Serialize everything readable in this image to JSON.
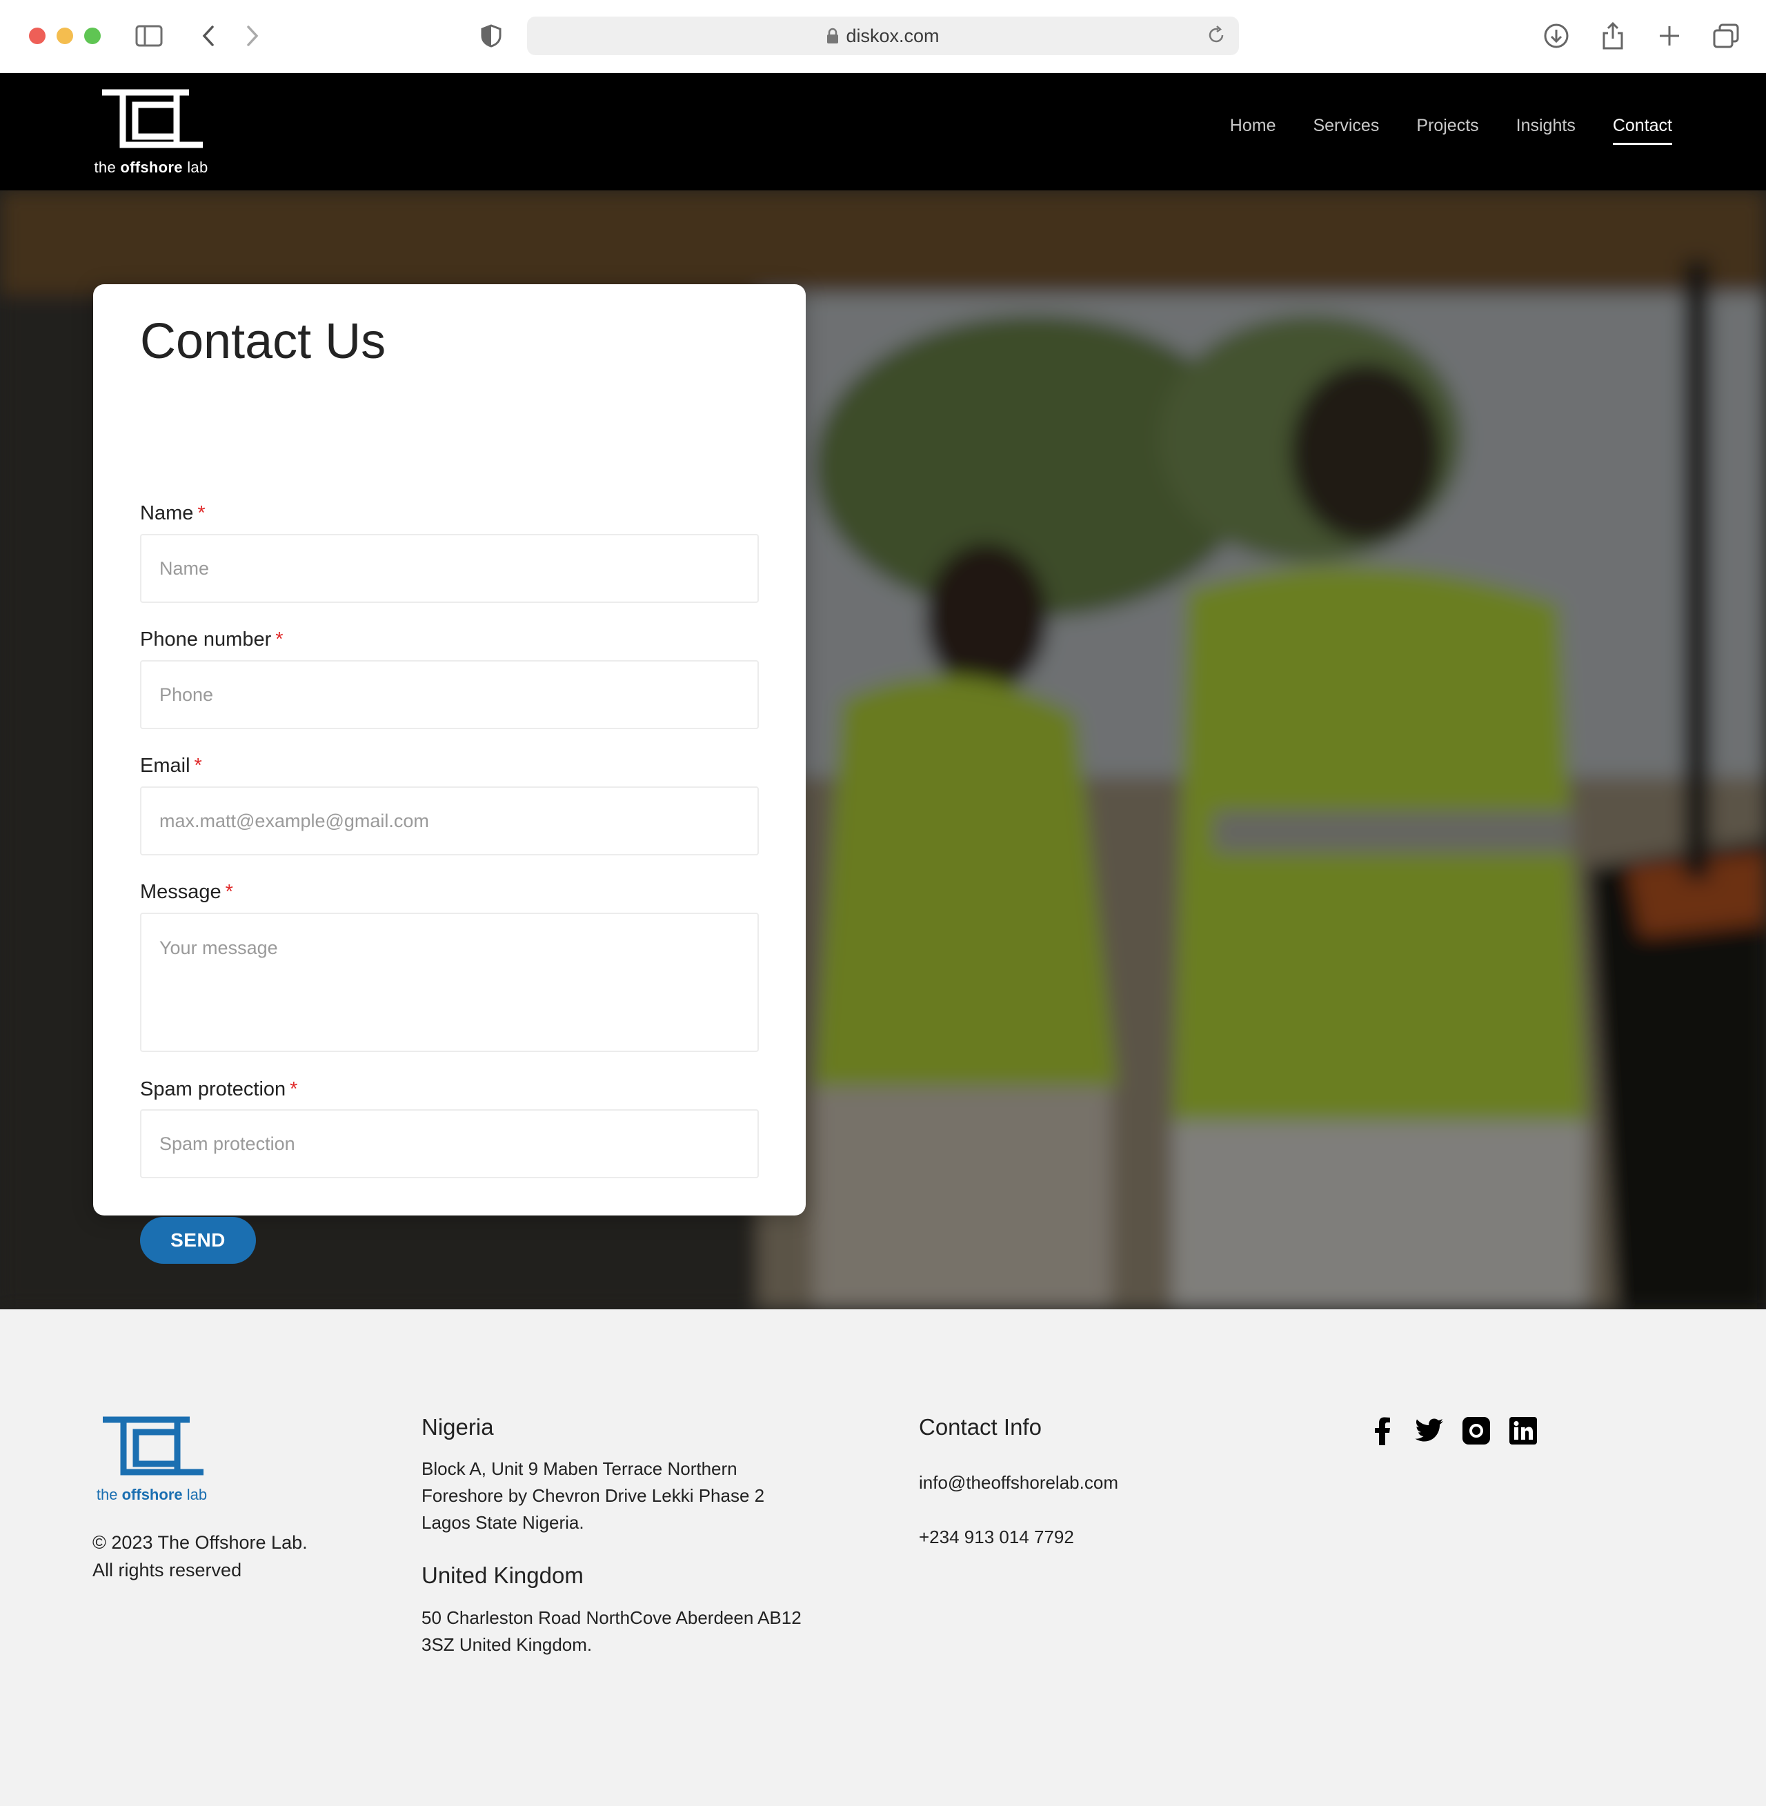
{
  "browser": {
    "url": "diskox.com"
  },
  "header": {
    "logo_text_1": "the ",
    "logo_text_2": "offshore",
    "logo_text_3": " lab",
    "nav": [
      "Home",
      "Services",
      "Projects",
      "Insights",
      "Contact"
    ],
    "active_nav": "Contact"
  },
  "form": {
    "title": "Contact Us",
    "fields": [
      {
        "label": "Name",
        "placeholder": "Name",
        "required": "*"
      },
      {
        "label": "Phone number",
        "placeholder": "Phone",
        "required": "*"
      },
      {
        "label": "Email",
        "placeholder": "max.matt@example@gmail.com",
        "required": "*"
      },
      {
        "label": "Message",
        "placeholder": "Your message",
        "required": "*"
      },
      {
        "label": "Spam protection",
        "placeholder": "Spam protection",
        "required": "*"
      }
    ],
    "submit_label": "SEND"
  },
  "footer": {
    "logo_text_1": "the ",
    "logo_text_2": "offshore",
    "logo_text_3": " lab",
    "copyright_line1": "© 2023 The Offshore Lab.",
    "copyright_line2": "All rights reserved",
    "nigeria_title": "Nigeria",
    "nigeria_line1": "Block A, Unit 9 Maben Terrace Northern",
    "nigeria_line2": "Foreshore by Chevron Drive Lekki Phase 2",
    "nigeria_line3": "Lagos State Nigeria.",
    "uk_title": "United Kingdom",
    "uk_line1": "50 Charleston Road NorthCove Aberdeen AB12",
    "uk_line2": "3SZ United Kingdom.",
    "contact_title": "Contact Info",
    "email": "info@theoffshorelab.com",
    "phone": "+234 913 014 7792",
    "social": [
      "facebook-icon",
      "twitter-icon",
      "instagram-icon",
      "linkedin-icon"
    ]
  },
  "colors": {
    "accent": "#1b6fb1",
    "required": "#e02b2b",
    "header_bg": "#000000",
    "footer_bg": "#f2f2f2"
  }
}
